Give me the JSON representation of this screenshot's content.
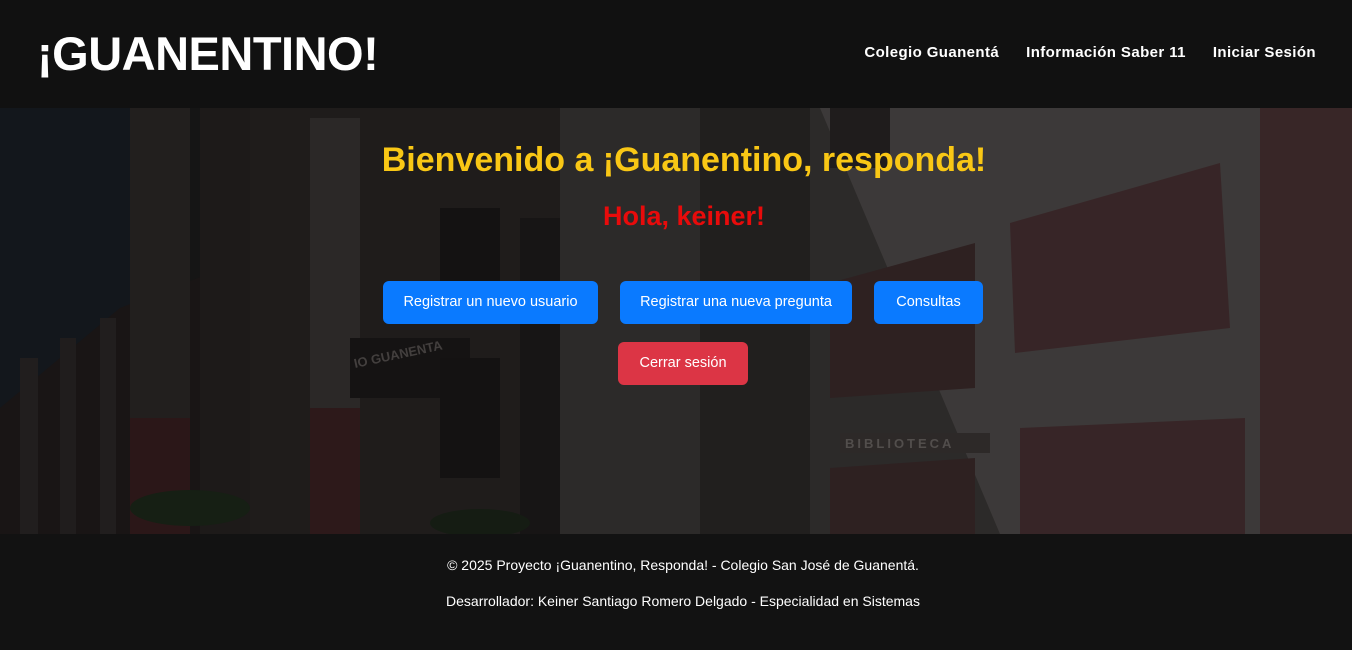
{
  "header": {
    "logo": "¡GUANENTINO!",
    "nav": [
      {
        "label": "Colegio Guanentá"
      },
      {
        "label": "Información Saber 11"
      },
      {
        "label": "Iniciar Sesión"
      }
    ]
  },
  "hero": {
    "welcome": "Bienvenido a ¡Guanentino, responda!",
    "greeting": "Hola, keiner!",
    "buttons": {
      "register_user": "Registrar un nuevo usuario",
      "register_question": "Registrar una nueva pregunta",
      "queries": "Consultas",
      "logout": "Cerrar sesión"
    },
    "background_signs": {
      "building_name": "IO GUANENTA",
      "library": "BIBLIOTECA"
    }
  },
  "footer": {
    "copyright": "© 2025 Proyecto ¡Guanentino, Responda! - Colegio San José de Guanentá.",
    "developer": "Desarrollador: Keiner Santiago Romero Delgado - Especialidad en Sistemas"
  },
  "colors": {
    "header_bg": "#111111",
    "welcome_text": "#f9c715",
    "greeting_text": "#e80b0b",
    "primary_button": "#0a7aff",
    "danger_button": "#dc3545"
  }
}
